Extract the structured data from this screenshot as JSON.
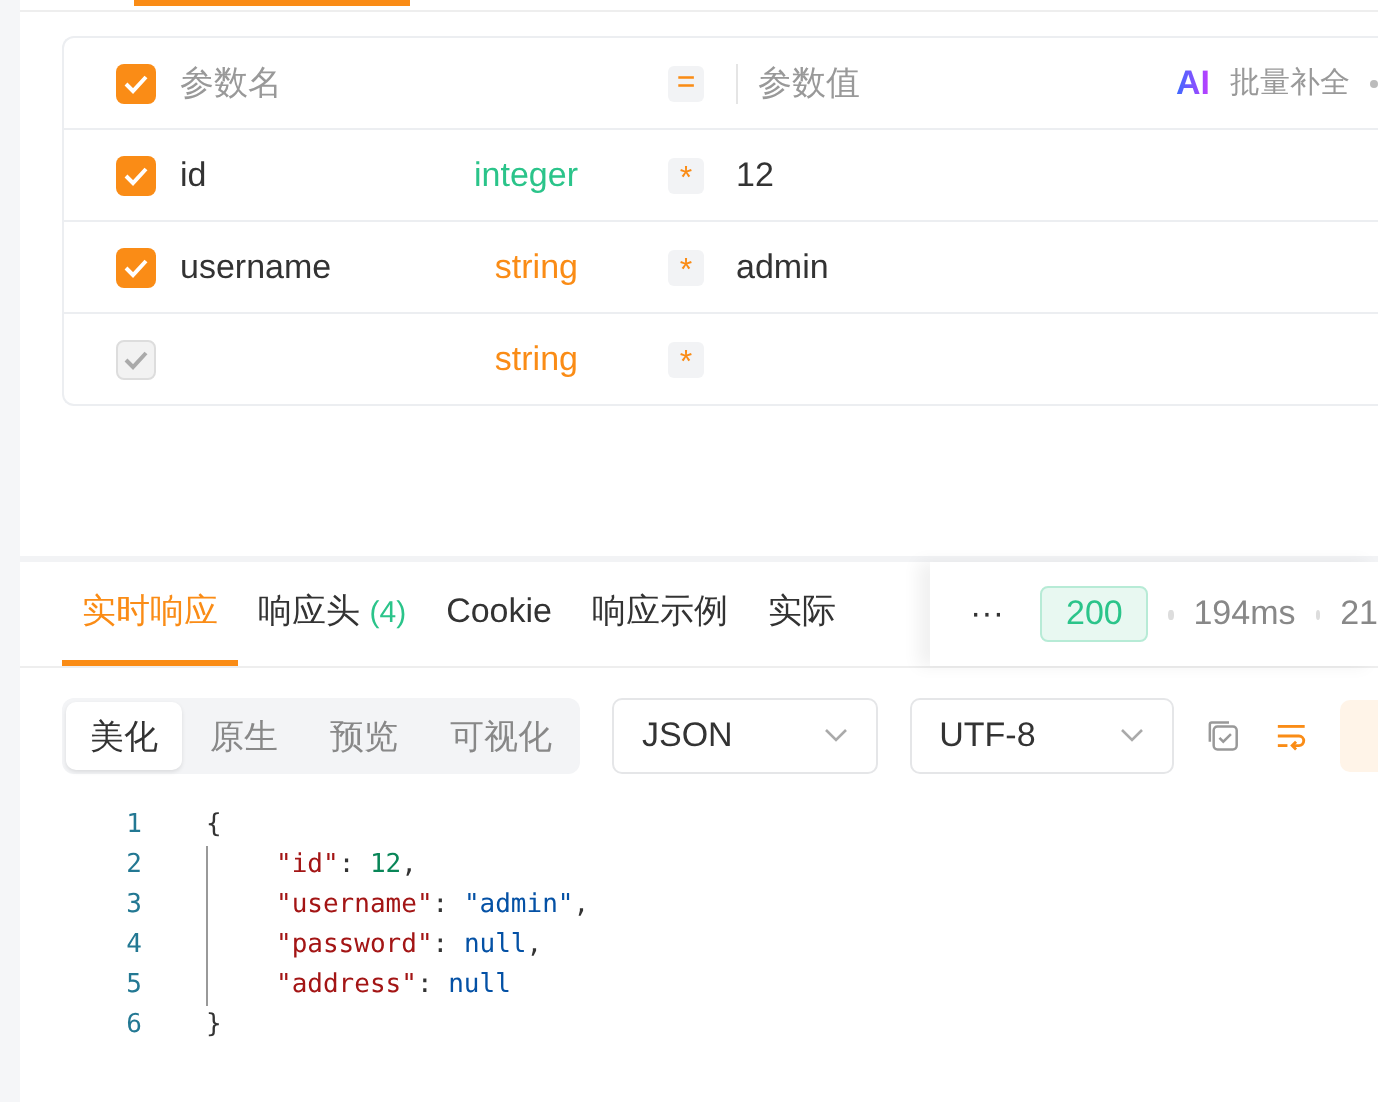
{
  "params": {
    "header": {
      "checked": true,
      "name_label": "参数名",
      "equals": "=",
      "value_label": "参数值",
      "ai_badge": "AI",
      "bulk_action": "批量补全"
    },
    "rows": [
      {
        "checked": true,
        "disabled": false,
        "name": "id",
        "type": "integer",
        "color": "#2bc48a",
        "required": "*",
        "value": "12"
      },
      {
        "checked": true,
        "disabled": false,
        "name": "username",
        "type": "string",
        "color": "#fa8c16",
        "required": "*",
        "value": "admin"
      },
      {
        "checked": true,
        "disabled": true,
        "type": "string",
        "color": "#fa8c16",
        "required": "*"
      }
    ]
  },
  "response": {
    "tabs": [
      {
        "label": "实时响应",
        "selected": true
      },
      {
        "label": "响应头",
        "count": "(4)",
        "selected": false
      },
      {
        "label": "Cookie",
        "selected": false
      },
      {
        "label": "响应示例",
        "selected": false
      },
      {
        "label": "实际",
        "selected": false
      }
    ],
    "more": "···",
    "status": "200",
    "time": "194ms",
    "size": "21",
    "views": [
      {
        "label": "美化",
        "selected": true
      },
      {
        "label": "原生",
        "selected": false
      },
      {
        "label": "预览",
        "selected": false
      },
      {
        "label": "可视化",
        "selected": false
      }
    ],
    "format": "JSON",
    "encoding": "UTF-8",
    "code": [
      {
        "number": "1",
        "tokens": [
          {
            "kind": "punct",
            "text": "{"
          }
        ],
        "children": [
          {
            "number": "2",
            "tokens": [
              {
                "kind": "key",
                "text": "\"id\""
              },
              {
                "kind": "punct",
                "text": ": "
              },
              {
                "kind": "number",
                "text": "12"
              },
              {
                "kind": "punct",
                "text": ","
              }
            ]
          },
          {
            "number": "3",
            "tokens": [
              {
                "kind": "key",
                "text": "\"username\""
              },
              {
                "kind": "punct",
                "text": ": "
              },
              {
                "kind": "string",
                "text": "\"admin\""
              },
              {
                "kind": "punct",
                "text": ","
              }
            ]
          },
          {
            "number": "4",
            "tokens": [
              {
                "kind": "key",
                "text": "\"password\""
              },
              {
                "kind": "punct",
                "text": ": "
              },
              {
                "kind": "null",
                "text": "null"
              },
              {
                "kind": "punct",
                "text": ","
              }
            ]
          },
          {
            "number": "5",
            "tokens": [
              {
                "kind": "key",
                "text": "\"address\""
              },
              {
                "kind": "punct",
                "text": ": "
              },
              {
                "kind": "null",
                "text": "null"
              }
            ]
          }
        ]
      },
      {
        "number": "6",
        "tokens": [
          {
            "kind": "punct",
            "text": "}"
          }
        ]
      }
    ]
  }
}
